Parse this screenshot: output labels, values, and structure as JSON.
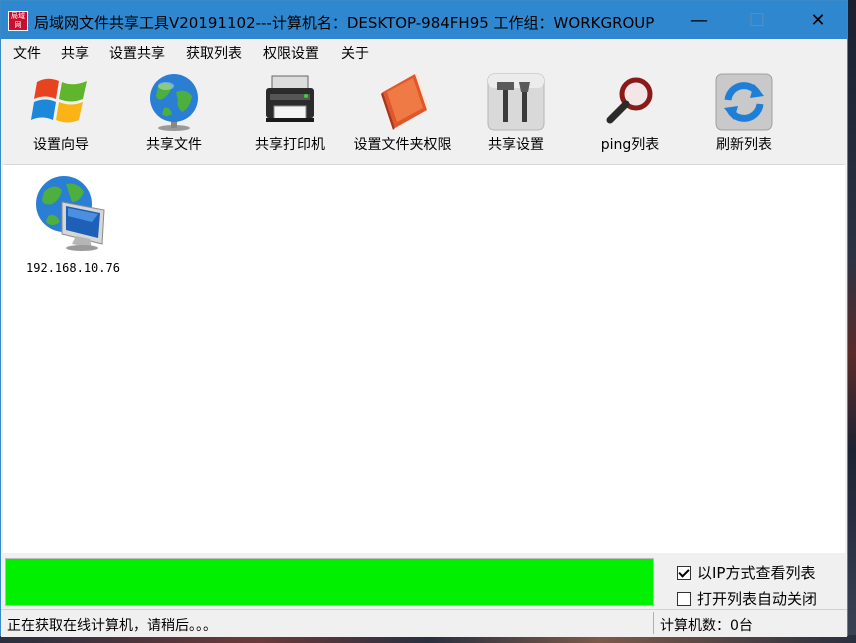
{
  "window": {
    "title": "局域网文件共享工具V20191102---计算机名：DESKTOP-984FH95  工作组：WORKGROUP",
    "app_icon_text": "局域网",
    "min_glyph": "—",
    "max_glyph": "☐",
    "close_glyph": "✕",
    "titlebar_color": "#2f87cf"
  },
  "menu": {
    "items": [
      "文件",
      "共享",
      "设置共享",
      "获取列表",
      "权限设置",
      "关于"
    ]
  },
  "toolbar": {
    "items": [
      {
        "label": "设置向导",
        "icon": "windows-logo-icon"
      },
      {
        "label": "共享文件",
        "icon": "globe-icon"
      },
      {
        "label": "共享打印机",
        "icon": "printer-icon"
      },
      {
        "label": "设置文件夹权限",
        "icon": "folder-book-icon"
      },
      {
        "label": "共享设置",
        "icon": "tools-icon"
      },
      {
        "label": "ping列表",
        "icon": "magnifier-icon"
      },
      {
        "label": "刷新列表",
        "icon": "refresh-icon"
      }
    ]
  },
  "hosts": [
    {
      "ip": "192.168.10.76",
      "icon": "network-computer-icon"
    }
  ],
  "progress": {
    "value_percent": 100,
    "color": "#00f000"
  },
  "options": {
    "view_by_ip": {
      "label": "以IP方式查看列表",
      "checked": true
    },
    "auto_close": {
      "label": "打开列表自动关闭",
      "checked": false
    }
  },
  "status": {
    "left": "正在获取在线计算机，请稍后。。。",
    "right": "计算机数：0台"
  }
}
